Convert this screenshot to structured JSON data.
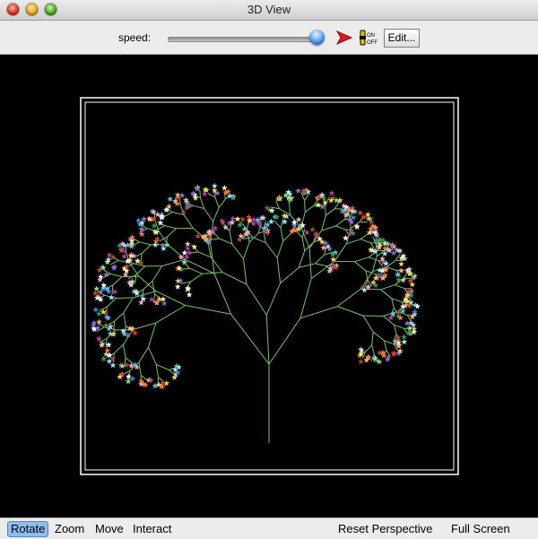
{
  "window": {
    "title": "3D View"
  },
  "toolbar": {
    "speed_label": "speed:",
    "speed_value": 1.0,
    "edit_label": "Edit...",
    "onoff_top": "ON",
    "onoff_bottom": "OFF",
    "play_icon_color": "#d7191f"
  },
  "viewport": {
    "background": "#000000",
    "frame_color": "#ffffff",
    "branch_color": "#7cc16a"
  },
  "modes": [
    {
      "label": "Rotate",
      "active": true
    },
    {
      "label": "Zoom",
      "active": false
    },
    {
      "label": "Move",
      "active": false
    },
    {
      "label": "Interact",
      "active": false
    }
  ],
  "actions": {
    "reset_label": "Reset Perspective",
    "fullscreen_label": "Full Screen"
  }
}
